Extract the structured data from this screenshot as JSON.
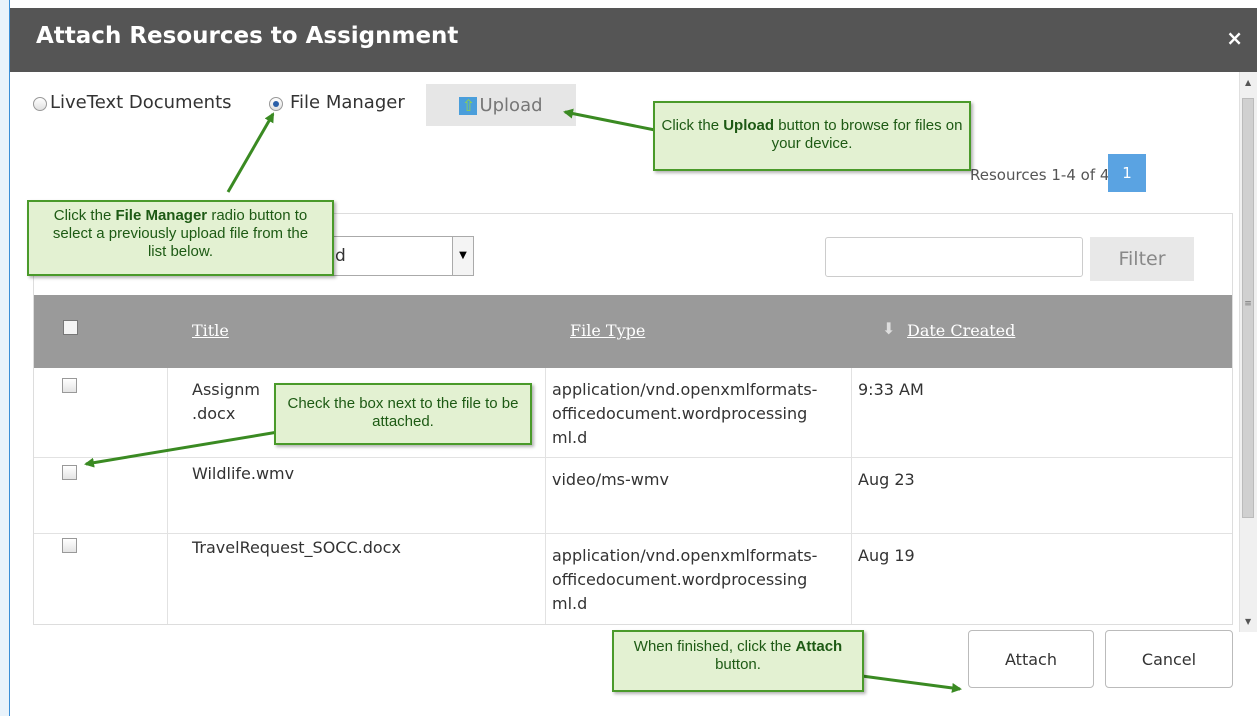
{
  "dialog": {
    "title": "Attach Resources to Assignment",
    "close_label": "×"
  },
  "source": {
    "option1_label": "LiveText Documents",
    "option2_label": "File Manager",
    "selected": "File Manager",
    "upload_label": "Upload"
  },
  "pagination": {
    "count_text": "Resources 1-4 of 4",
    "current_page": "1"
  },
  "toolbar": {
    "select_value": "d",
    "filter_placeholder": "",
    "filter_label": "Filter"
  },
  "table": {
    "headers": {
      "title": "Title",
      "file_type": "File Type",
      "date_created": "Date Created"
    },
    "rows": [
      {
        "title": "Assignm\n.docx",
        "file_type": "application/vnd.openxmlformats-\nofficedocument.wordprocessing\nml.d",
        "date": "9:33 AM"
      },
      {
        "title": "Wildlife.wmv",
        "file_type": "video/ms-wmv",
        "date": "Aug 23"
      },
      {
        "title": "TravelRequest_SOCC.docx",
        "file_type": "application/vnd.openxmlformats-\nofficedocument.wordprocessing\nml.d",
        "date": "Aug 19"
      }
    ]
  },
  "actions": {
    "attach_label": "Attach",
    "cancel_label": "Cancel"
  },
  "callouts": {
    "upload": {
      "pre": "Click the ",
      "bold": "Upload",
      "post": " button to browse for files on your device."
    },
    "file_manager": {
      "pre": "Click the ",
      "bold": "File Manager",
      "post": " radio button to select a previously upload file from the list below."
    },
    "checkbox": {
      "text": "Check the box next to the file to be attached."
    },
    "attach": {
      "pre": "When finished, click the ",
      "bold": "Attach",
      "post": " button."
    }
  },
  "colors": {
    "titlebar": "#555555",
    "accent": "#5aa3e2",
    "callout_bg": "#e3f1d2",
    "callout_border": "#4a9a2a"
  }
}
